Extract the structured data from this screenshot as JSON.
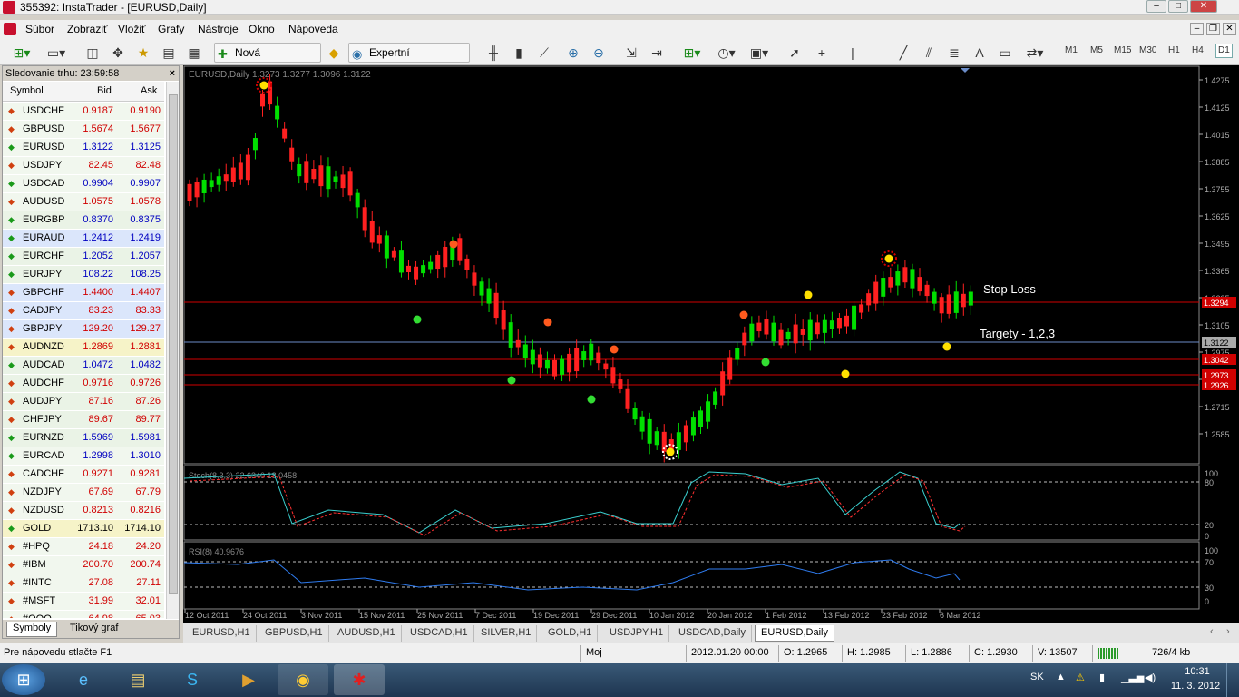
{
  "window": {
    "title": "355392: InstaTrader - [EURUSD,Daily]",
    "min": "–",
    "max": "□",
    "close": "✕"
  },
  "menu": [
    "Súbor",
    "Zobraziť",
    "Vložiť",
    "Grafy",
    "Nástroje",
    "Okno",
    "Nápoveda"
  ],
  "toolbar": {
    "new_order": "Nová objednávka",
    "expert_advisors": "Expertní poradcovia",
    "timeframes": [
      "M1",
      "M5",
      "M15",
      "M30",
      "H1",
      "H4",
      "D1"
    ],
    "active_timeframe": "D1"
  },
  "market_watch": {
    "title": "Sledovanie trhu: 23:59:58",
    "close": "×",
    "columns": {
      "symbol": "Symbol",
      "bid": "Bid",
      "ask": "Ask"
    },
    "rows": [
      {
        "symbol": "USDCHF",
        "bid": "0.9187",
        "ask": "0.9190",
        "dir": "down",
        "bid_color": "#d00000",
        "ask_color": "#d00000"
      },
      {
        "symbol": "GBPUSD",
        "bid": "1.5674",
        "ask": "1.5677",
        "dir": "down",
        "bid_color": "#d00000",
        "ask_color": "#d00000"
      },
      {
        "symbol": "EURUSD",
        "bid": "1.3122",
        "ask": "1.3125",
        "dir": "up",
        "bid_color": "#0000c0",
        "ask_color": "#0000c0"
      },
      {
        "symbol": "USDJPY",
        "bid": "82.45",
        "ask": "82.48",
        "dir": "down",
        "bid_color": "#d00000",
        "ask_color": "#d00000"
      },
      {
        "symbol": "USDCAD",
        "bid": "0.9904",
        "ask": "0.9907",
        "dir": "up",
        "bid_color": "#0000c0",
        "ask_color": "#0000c0"
      },
      {
        "symbol": "AUDUSD",
        "bid": "1.0575",
        "ask": "1.0578",
        "dir": "down",
        "bid_color": "#d00000",
        "ask_color": "#d00000"
      },
      {
        "symbol": "EURGBP",
        "bid": "0.8370",
        "ask": "0.8375",
        "dir": "up",
        "bid_color": "#0000c0",
        "ask_color": "#0000c0"
      },
      {
        "symbol": "EURAUD",
        "bid": "1.2412",
        "ask": "1.2419",
        "dir": "up",
        "bid_color": "#0000c0",
        "ask_color": "#0000c0"
      },
      {
        "symbol": "EURCHF",
        "bid": "1.2052",
        "ask": "1.2057",
        "dir": "up",
        "bid_color": "#0000c0",
        "ask_color": "#0000c0"
      },
      {
        "symbol": "EURJPY",
        "bid": "108.22",
        "ask": "108.25",
        "dir": "up",
        "bid_color": "#0000c0",
        "ask_color": "#0000c0"
      },
      {
        "symbol": "GBPCHF",
        "bid": "1.4400",
        "ask": "1.4407",
        "dir": "down",
        "bid_color": "#d00000",
        "ask_color": "#d00000"
      },
      {
        "symbol": "CADJPY",
        "bid": "83.23",
        "ask": "83.33",
        "dir": "down",
        "bid_color": "#d00000",
        "ask_color": "#d00000"
      },
      {
        "symbol": "GBPJPY",
        "bid": "129.20",
        "ask": "129.27",
        "dir": "down",
        "bid_color": "#d00000",
        "ask_color": "#d00000"
      },
      {
        "symbol": "AUDNZD",
        "bid": "1.2869",
        "ask": "1.2881",
        "dir": "down",
        "bid_color": "#d00000",
        "ask_color": "#d00000"
      },
      {
        "symbol": "AUDCAD",
        "bid": "1.0472",
        "ask": "1.0482",
        "dir": "up",
        "bid_color": "#0000c0",
        "ask_color": "#0000c0"
      },
      {
        "symbol": "AUDCHF",
        "bid": "0.9716",
        "ask": "0.9726",
        "dir": "down",
        "bid_color": "#d00000",
        "ask_color": "#d00000"
      },
      {
        "symbol": "AUDJPY",
        "bid": "87.16",
        "ask": "87.26",
        "dir": "down",
        "bid_color": "#d00000",
        "ask_color": "#d00000"
      },
      {
        "symbol": "CHFJPY",
        "bid": "89.67",
        "ask": "89.77",
        "dir": "down",
        "bid_color": "#d00000",
        "ask_color": "#d00000"
      },
      {
        "symbol": "EURNZD",
        "bid": "1.5969",
        "ask": "1.5981",
        "dir": "up",
        "bid_color": "#0000c0",
        "ask_color": "#0000c0"
      },
      {
        "symbol": "EURCAD",
        "bid": "1.2998",
        "ask": "1.3010",
        "dir": "up",
        "bid_color": "#0000c0",
        "ask_color": "#0000c0"
      },
      {
        "symbol": "CADCHF",
        "bid": "0.9271",
        "ask": "0.9281",
        "dir": "down",
        "bid_color": "#d00000",
        "ask_color": "#d00000"
      },
      {
        "symbol": "NZDJPY",
        "bid": "67.69",
        "ask": "67.79",
        "dir": "down",
        "bid_color": "#d00000",
        "ask_color": "#d00000"
      },
      {
        "symbol": "NZDUSD",
        "bid": "0.8213",
        "ask": "0.8216",
        "dir": "down",
        "bid_color": "#d00000",
        "ask_color": "#d00000"
      },
      {
        "symbol": "GOLD",
        "bid": "1713.10",
        "ask": "1714.10",
        "dir": "up",
        "bid_color": "#000000",
        "ask_color": "#000000"
      },
      {
        "symbol": "#HPQ",
        "bid": "24.18",
        "ask": "24.20",
        "dir": "down",
        "bid_color": "#d00000",
        "ask_color": "#d00000"
      },
      {
        "symbol": "#IBM",
        "bid": "200.70",
        "ask": "200.74",
        "dir": "down",
        "bid_color": "#d00000",
        "ask_color": "#d00000"
      },
      {
        "symbol": "#INTC",
        "bid": "27.08",
        "ask": "27.11",
        "dir": "down",
        "bid_color": "#d00000",
        "ask_color": "#d00000"
      },
      {
        "symbol": "#MSFT",
        "bid": "31.99",
        "ask": "32.01",
        "dir": "down",
        "bid_color": "#d00000",
        "ask_color": "#d00000"
      },
      {
        "symbol": "#QQQ",
        "bid": "64.98",
        "ask": "65.03",
        "dir": "down",
        "bid_color": "#d00000",
        "ask_color": "#d00000"
      }
    ],
    "tabs": [
      "Symboly",
      "Tikový graf"
    ]
  },
  "chart": {
    "info": "EURUSD,Daily  1.3273 1.3277 1.3096 1.3122",
    "stoch_label": "Stoch(8,3,3) 22.6340 18.0458",
    "rsi_label": "RSI(8) 40.9676",
    "annot_stop": "Stop Loss",
    "annot_targets": "Targety - 1,2,3",
    "price_ticks": [
      "1.4275",
      "1.4125",
      "1.4015",
      "1.3885",
      "1.3755",
      "1.3625",
      "1.3495",
      "1.3365",
      "1.3235",
      "1.3105",
      "1.2975",
      "1.2845",
      "1.2715",
      "1.2585"
    ],
    "hline_labels": [
      "1.3294",
      "1.3122",
      "1.3042",
      "1.2973",
      "1.2926"
    ],
    "stoch_ticks": [
      "100",
      "80",
      "20",
      "0"
    ],
    "rsi_ticks": [
      "100",
      "70",
      "30",
      "0"
    ],
    "date_ticks": [
      "12 Oct 2011",
      "24 Oct 2011",
      "3 Nov 2011",
      "15 Nov 2011",
      "25 Nov 2011",
      "7 Dec 2011",
      "19 Dec 2011",
      "29 Dec 2011",
      "10 Jan 2012",
      "20 Jan 2012",
      "1 Feb 2012",
      "13 Feb 2012",
      "23 Feb 2012",
      "6 Mar 2012"
    ],
    "colors": {
      "bull": "#00e000",
      "bear": "#ff0000",
      "bg": "#000000",
      "grid": "#808080"
    }
  },
  "chart_tabs": [
    "EURUSD,H1",
    "GBPUSD,H1",
    "AUDUSD,H1",
    "USDCAD,H1",
    "SILVER,H1",
    "GOLD,H1",
    "USDJPY,H1",
    "USDCAD,Daily",
    "EURUSD,Daily"
  ],
  "active_chart_tab": "EURUSD,Daily",
  "status": {
    "help": "Pre nápovedu stlačte F1",
    "profile": "Moj",
    "datetime": "2012.01.20 00:00",
    "open": "O: 1.2965",
    "high": "H: 1.2985",
    "low": "L: 1.2886",
    "close": "C: 1.2930",
    "volume": "V: 13507",
    "traffic": "726/4 kb"
  },
  "taskbar": {
    "lang": "SK",
    "time": "10:31",
    "date": "11. 3. 2012"
  }
}
